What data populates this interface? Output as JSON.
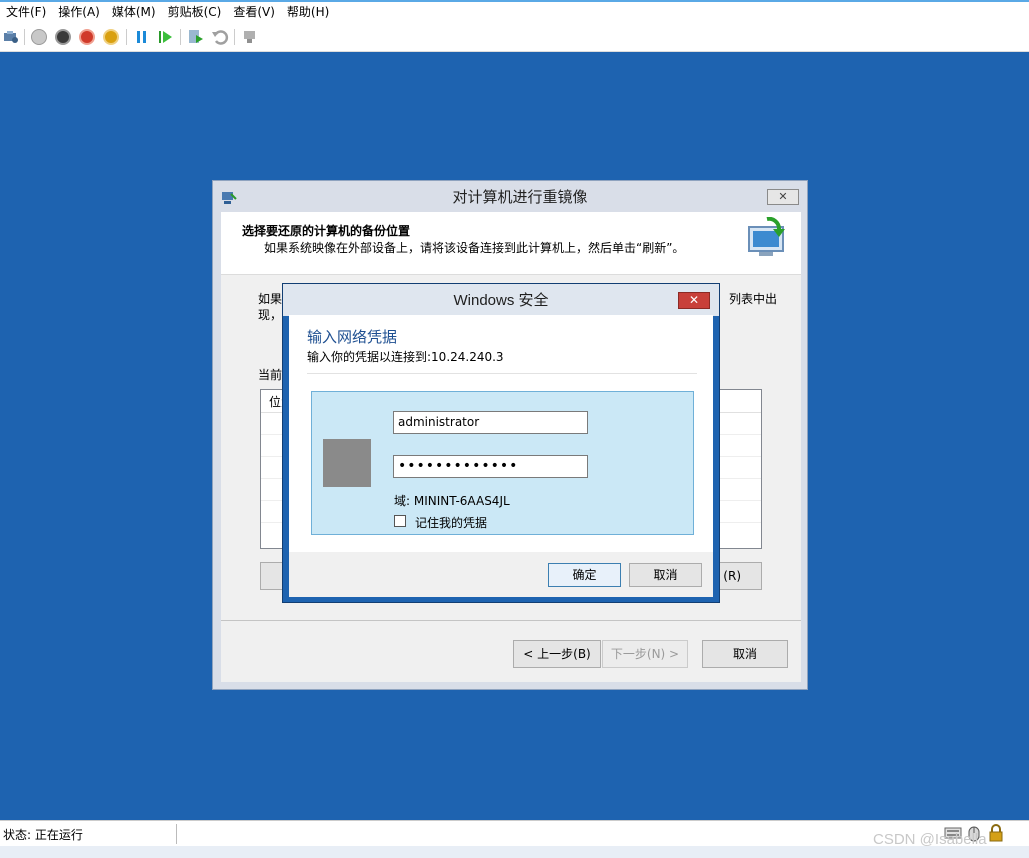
{
  "menu": [
    "文件(F)",
    "操作(A)",
    "媒体(M)",
    "剪贴板(C)",
    "查看(V)",
    "帮助(H)"
  ],
  "toolbar_icons": [
    "ctrl-alt-del-icon",
    "start-icon",
    "turn-off-icon",
    "shutdown-icon",
    "power-icon",
    "pause-icon",
    "resume-icon",
    "checkpoint-icon",
    "revert-icon",
    "enhanced-session-icon"
  ],
  "status": {
    "text": "状态: 正在运行",
    "watermark": "CSDN @Isabella"
  },
  "wizard": {
    "title": "对计算机进行重镜像",
    "heading": "选择要还原的计算机的备份位置",
    "subheading": "如果系统映像在外部设备上，请将该设备连接到此计算机上，然后单击“刷新”。",
    "para_left_1": "如果",
    "para_left_2": "现，",
    "para_right": "列表中出",
    "current_label": "当前",
    "list_header": "位置",
    "partial_button": "(R)",
    "back_button": "< 上一步(B)",
    "next_button": "下一步(N) >",
    "cancel_button": "取消"
  },
  "security": {
    "title": "Windows 安全",
    "close": "✕",
    "heading": "输入网络凭据",
    "subheading": "输入你的凭据以连接到:10.24.240.3",
    "username": "administrator",
    "password": "•••••••••••••",
    "domain": "域: MININT-6AAS4JL",
    "remember": "记住我的凭据",
    "ok": "确定",
    "cancel": "取消"
  }
}
